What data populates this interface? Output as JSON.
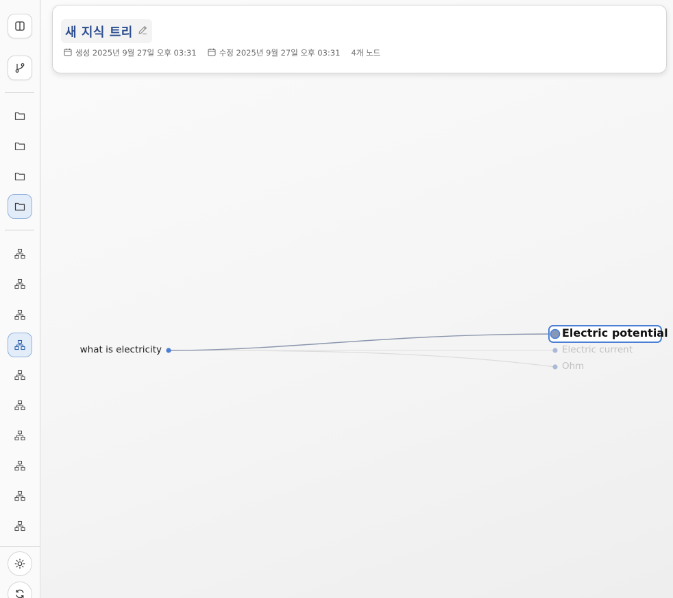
{
  "sidebar": {
    "top_buttons": [
      {
        "icon": "panel-toggle-icon"
      },
      {
        "icon": "git-branch-icon"
      }
    ],
    "folders": [
      {
        "icon": "folder-icon",
        "active": false
      },
      {
        "icon": "folder-icon",
        "active": false
      },
      {
        "icon": "folder-icon",
        "active": false
      },
      {
        "icon": "folder-icon",
        "active": true
      }
    ],
    "trees": [
      {
        "icon": "hierarchy-icon",
        "active": false
      },
      {
        "icon": "hierarchy-icon",
        "active": false
      },
      {
        "icon": "hierarchy-icon",
        "active": false
      },
      {
        "icon": "hierarchy-icon",
        "active": true
      },
      {
        "icon": "hierarchy-icon",
        "active": false
      },
      {
        "icon": "hierarchy-icon",
        "active": false
      },
      {
        "icon": "hierarchy-icon",
        "active": false
      },
      {
        "icon": "hierarchy-icon",
        "active": false
      },
      {
        "icon": "hierarchy-icon",
        "active": false
      },
      {
        "icon": "hierarchy-icon",
        "active": false
      }
    ],
    "bottom_buttons": [
      {
        "icon": "sun-icon"
      },
      {
        "icon": "refresh-icon"
      }
    ]
  },
  "header": {
    "title": "새 지식 트리",
    "created": "생성 2025년 9월 27일 오후 03:31",
    "modified": "수정 2025년 9월 27일 오후 03:31",
    "node_count": "4개 노드"
  },
  "tree": {
    "root": {
      "label": "what is electricity"
    },
    "children": [
      {
        "label": "Electric potential",
        "selected": true
      },
      {
        "label": "Electric current",
        "selected": false
      },
      {
        "label": "Ohm",
        "selected": false
      }
    ]
  },
  "colors": {
    "accent": "#4a7fd4",
    "title": "#2b4d8f",
    "active_bg": "#e3edfa",
    "muted_text": "#c2c2c2",
    "link_strong": "#8a96ad",
    "link_faint": "#dcdcdc"
  }
}
